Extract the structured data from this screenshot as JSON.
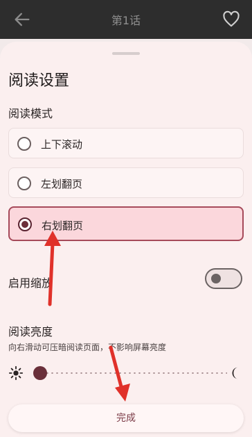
{
  "topbar": {
    "title": "第1话",
    "back_icon": "arrow-left-icon",
    "favorite_icon": "heart-outline-icon"
  },
  "sheet": {
    "title": "阅读设置",
    "reading_mode": {
      "label": "阅读模式",
      "options": [
        {
          "label": "上下滚动",
          "selected": false
        },
        {
          "label": "左划翻页",
          "selected": false
        },
        {
          "label": "右划翻页",
          "selected": true
        }
      ]
    },
    "zoom": {
      "label": "启用缩放",
      "enabled": false
    },
    "brightness": {
      "label": "阅读亮度",
      "caption": "向右滑动可压暗阅读页面，不影响屏幕亮度",
      "level": 0.04
    },
    "done_label": "完成"
  },
  "colors": {
    "accent": "#6a2f3a",
    "selected_bg": "#fbd7dc",
    "sheet_bg": "#fbefef",
    "annotation": "#e0312a"
  }
}
